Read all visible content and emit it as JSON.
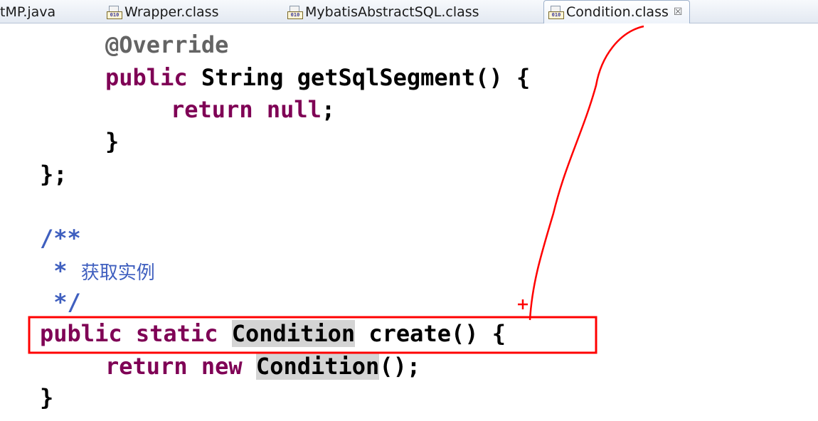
{
  "tabs": [
    {
      "label": "tMP.java",
      "icon": "java-file-icon",
      "active": false
    },
    {
      "label": "Wrapper.class",
      "icon": "class-file-icon",
      "active": false
    },
    {
      "label": "MybatisAbstractSQL.class",
      "icon": "class-file-icon",
      "active": false
    },
    {
      "label": "Condition.class",
      "icon": "class-file-icon",
      "active": true,
      "close": "☒"
    }
  ],
  "icon_badge": "010",
  "code": {
    "l1": {
      "ann": "@Override"
    },
    "l2": {
      "kw": "public",
      "rest": " String getSqlSegment() {"
    },
    "l3": {
      "kw1": "return",
      "kw2": "null",
      "rest": ";"
    },
    "l4": {
      "text": "}"
    },
    "l5": {
      "text": "};"
    },
    "l6": {
      "text": "/**"
    },
    "l7": {
      "star": " * ",
      "doc": "获取实例"
    },
    "l8": {
      "text": " */"
    },
    "l9": {
      "kw1": "public",
      "kw2": "static",
      "type": "Condition",
      "rest": " create() {"
    },
    "l10": {
      "kw1": "return",
      "kw2": "new",
      "type": "Condition",
      "rest": "();"
    },
    "l11": {
      "text": "}"
    }
  },
  "annotation_color": "#ff0000"
}
